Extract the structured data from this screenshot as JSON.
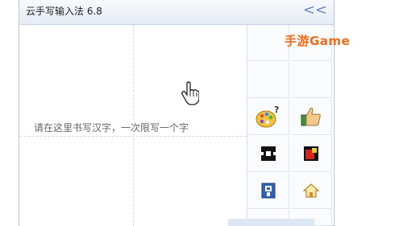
{
  "window": {
    "title": "云手写输入法 6.8",
    "collapse_symbol": "<<"
  },
  "canvas": {
    "hint": "请在这里书写汉字，一次限写一个字"
  },
  "panel": {
    "buttons": [
      {
        "id": "empty-1",
        "icon": ""
      },
      {
        "id": "empty-2",
        "icon": ""
      },
      {
        "id": "empty-3",
        "icon": ""
      },
      {
        "id": "empty-4",
        "icon": ""
      },
      {
        "id": "palette-help",
        "icon": "palette-help-icon"
      },
      {
        "id": "thumbs-up",
        "icon": "thumbs-up-icon"
      },
      {
        "id": "black-square",
        "icon": "black-square-icon"
      },
      {
        "id": "red-square",
        "icon": "red-black-square-icon"
      },
      {
        "id": "blue-tool",
        "icon": "blue-tool-icon"
      },
      {
        "id": "home",
        "icon": "home-icon"
      }
    ]
  },
  "overlay": {
    "watermark": "手游Game"
  },
  "colors": {
    "accent": "#6b86c6",
    "watermark": "#f26a18",
    "border": "#b9c7dc"
  }
}
